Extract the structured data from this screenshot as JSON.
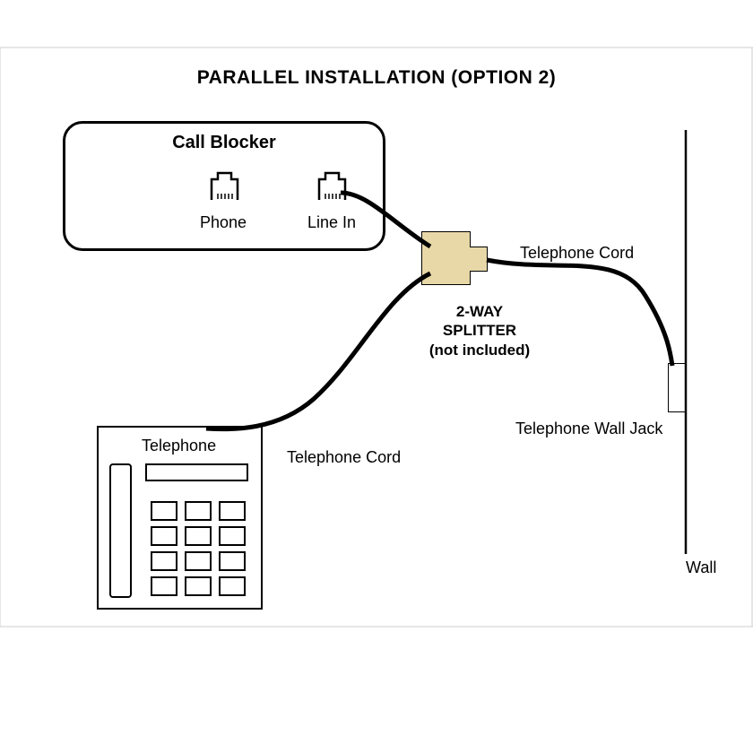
{
  "title": "PARALLEL INSTALLATION (OPTION 2)",
  "call_blocker": {
    "title": "Call Blocker",
    "port_phone": "Phone",
    "port_line": "Line In"
  },
  "splitter": {
    "line1": "2-WAY",
    "line2": "SPLITTER",
    "line3": "(not included)"
  },
  "labels": {
    "telephone_cord_top": "Telephone Cord",
    "telephone_cord_bottom": "Telephone Cord",
    "wall_jack": "Telephone Wall Jack",
    "wall": "Wall",
    "telephone": "Telephone"
  }
}
